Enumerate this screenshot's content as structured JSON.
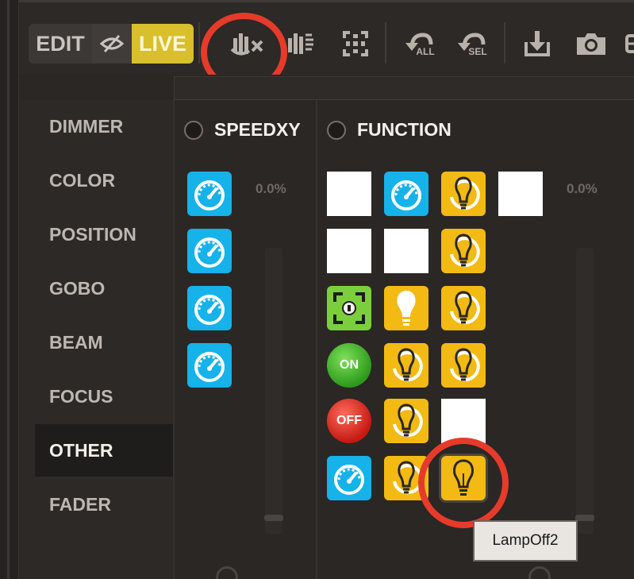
{
  "toolbar": {
    "mode_edit": "EDIT",
    "mode_live": "LIVE",
    "icons": [
      "hide-icon",
      "mute-sound-icon",
      "sound-wave-icon",
      "focus-grid-icon",
      "undo-all-icon",
      "undo-selection-icon",
      "download-icon",
      "camera-icon",
      "more-icon"
    ],
    "undo_all_label": "ALL",
    "undo_sel_label": "SEL"
  },
  "sidebar": {
    "items": [
      {
        "label": "DIMMER"
      },
      {
        "label": "COLOR"
      },
      {
        "label": "POSITION"
      },
      {
        "label": "GOBO"
      },
      {
        "label": "BEAM"
      },
      {
        "label": "FOCUS"
      },
      {
        "label": "OTHER",
        "active": true
      },
      {
        "label": "FADER"
      }
    ]
  },
  "speedxy": {
    "title": "SPEEDXY",
    "percent": "0.0%"
  },
  "function": {
    "title": "FUNCTION",
    "percent": "0.0%",
    "on_label": "ON",
    "off_label": "OFF"
  },
  "tooltip": {
    "text": "LampOff2"
  },
  "colors": {
    "live_accent": "#d9bf2b",
    "speed_tile": "#16b2ea",
    "lamp_tile": "#f2ba12",
    "highlight_ring": "#e63b2a"
  }
}
